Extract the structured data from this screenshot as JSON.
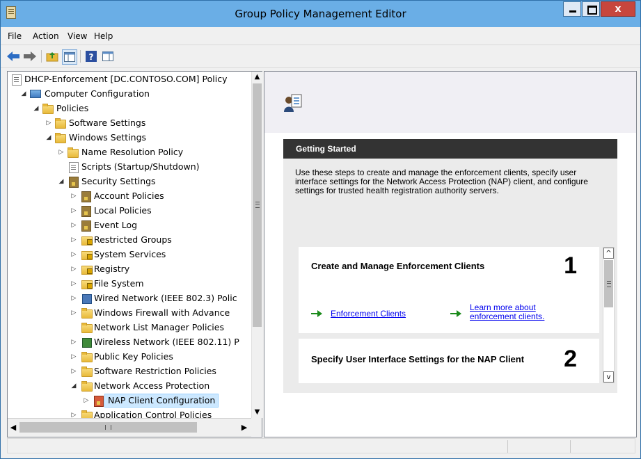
{
  "window": {
    "title": "Group Policy Management Editor",
    "close_glyph": "x"
  },
  "menu": {
    "items": [
      "File",
      "Action",
      "View",
      "Help"
    ]
  },
  "toolbar": {
    "icons": [
      "back-arrow-icon",
      "forward-arrow-icon",
      "up-folder-icon",
      "show-hide-tree-icon",
      "help-icon",
      "action-pane-icon"
    ]
  },
  "tree": {
    "root": "DHCP-Enforcement [DC.CONTOSO.COM] Policy",
    "items": [
      {
        "label": "Computer Configuration"
      },
      {
        "label": "Policies"
      },
      {
        "label": "Software Settings"
      },
      {
        "label": "Windows Settings"
      },
      {
        "label": "Name Resolution Policy"
      },
      {
        "label": "Scripts (Startup/Shutdown)"
      },
      {
        "label": "Security Settings"
      },
      {
        "label": "Account Policies"
      },
      {
        "label": "Local Policies"
      },
      {
        "label": "Event Log"
      },
      {
        "label": "Restricted Groups"
      },
      {
        "label": "System Services"
      },
      {
        "label": "Registry"
      },
      {
        "label": "File System"
      },
      {
        "label": "Wired Network (IEEE 802.3) Polic"
      },
      {
        "label": "Windows Firewall with Advance"
      },
      {
        "label": "Network List Manager Policies"
      },
      {
        "label": "Wireless Network (IEEE 802.11) P"
      },
      {
        "label": "Public Key Policies"
      },
      {
        "label": "Software Restriction Policies"
      },
      {
        "label": "Network Access Protection"
      },
      {
        "label": "NAP Client Configuration"
      },
      {
        "label": "Application Control Policies"
      }
    ]
  },
  "getting_started": {
    "title": "Getting Started",
    "description": "Use these steps to create and manage the enforcement clients, specify user interface settings for the Network Access Protection (NAP) client, and configure settings for trusted health registration authority servers."
  },
  "steps": [
    {
      "heading": "Create and Manage Enforcement Clients",
      "number": "1",
      "link1": "Enforcement Clients",
      "link2": "Learn more about enforcement clients."
    },
    {
      "heading": "Specify User Interface Settings for the NAP Client",
      "number": "2"
    }
  ],
  "colors": {
    "titlebar": "#6aaee6",
    "selection": "#cce8ff",
    "getting_started_header": "#333333",
    "link": "#0000ee",
    "arrow": "#1a8a1a"
  }
}
